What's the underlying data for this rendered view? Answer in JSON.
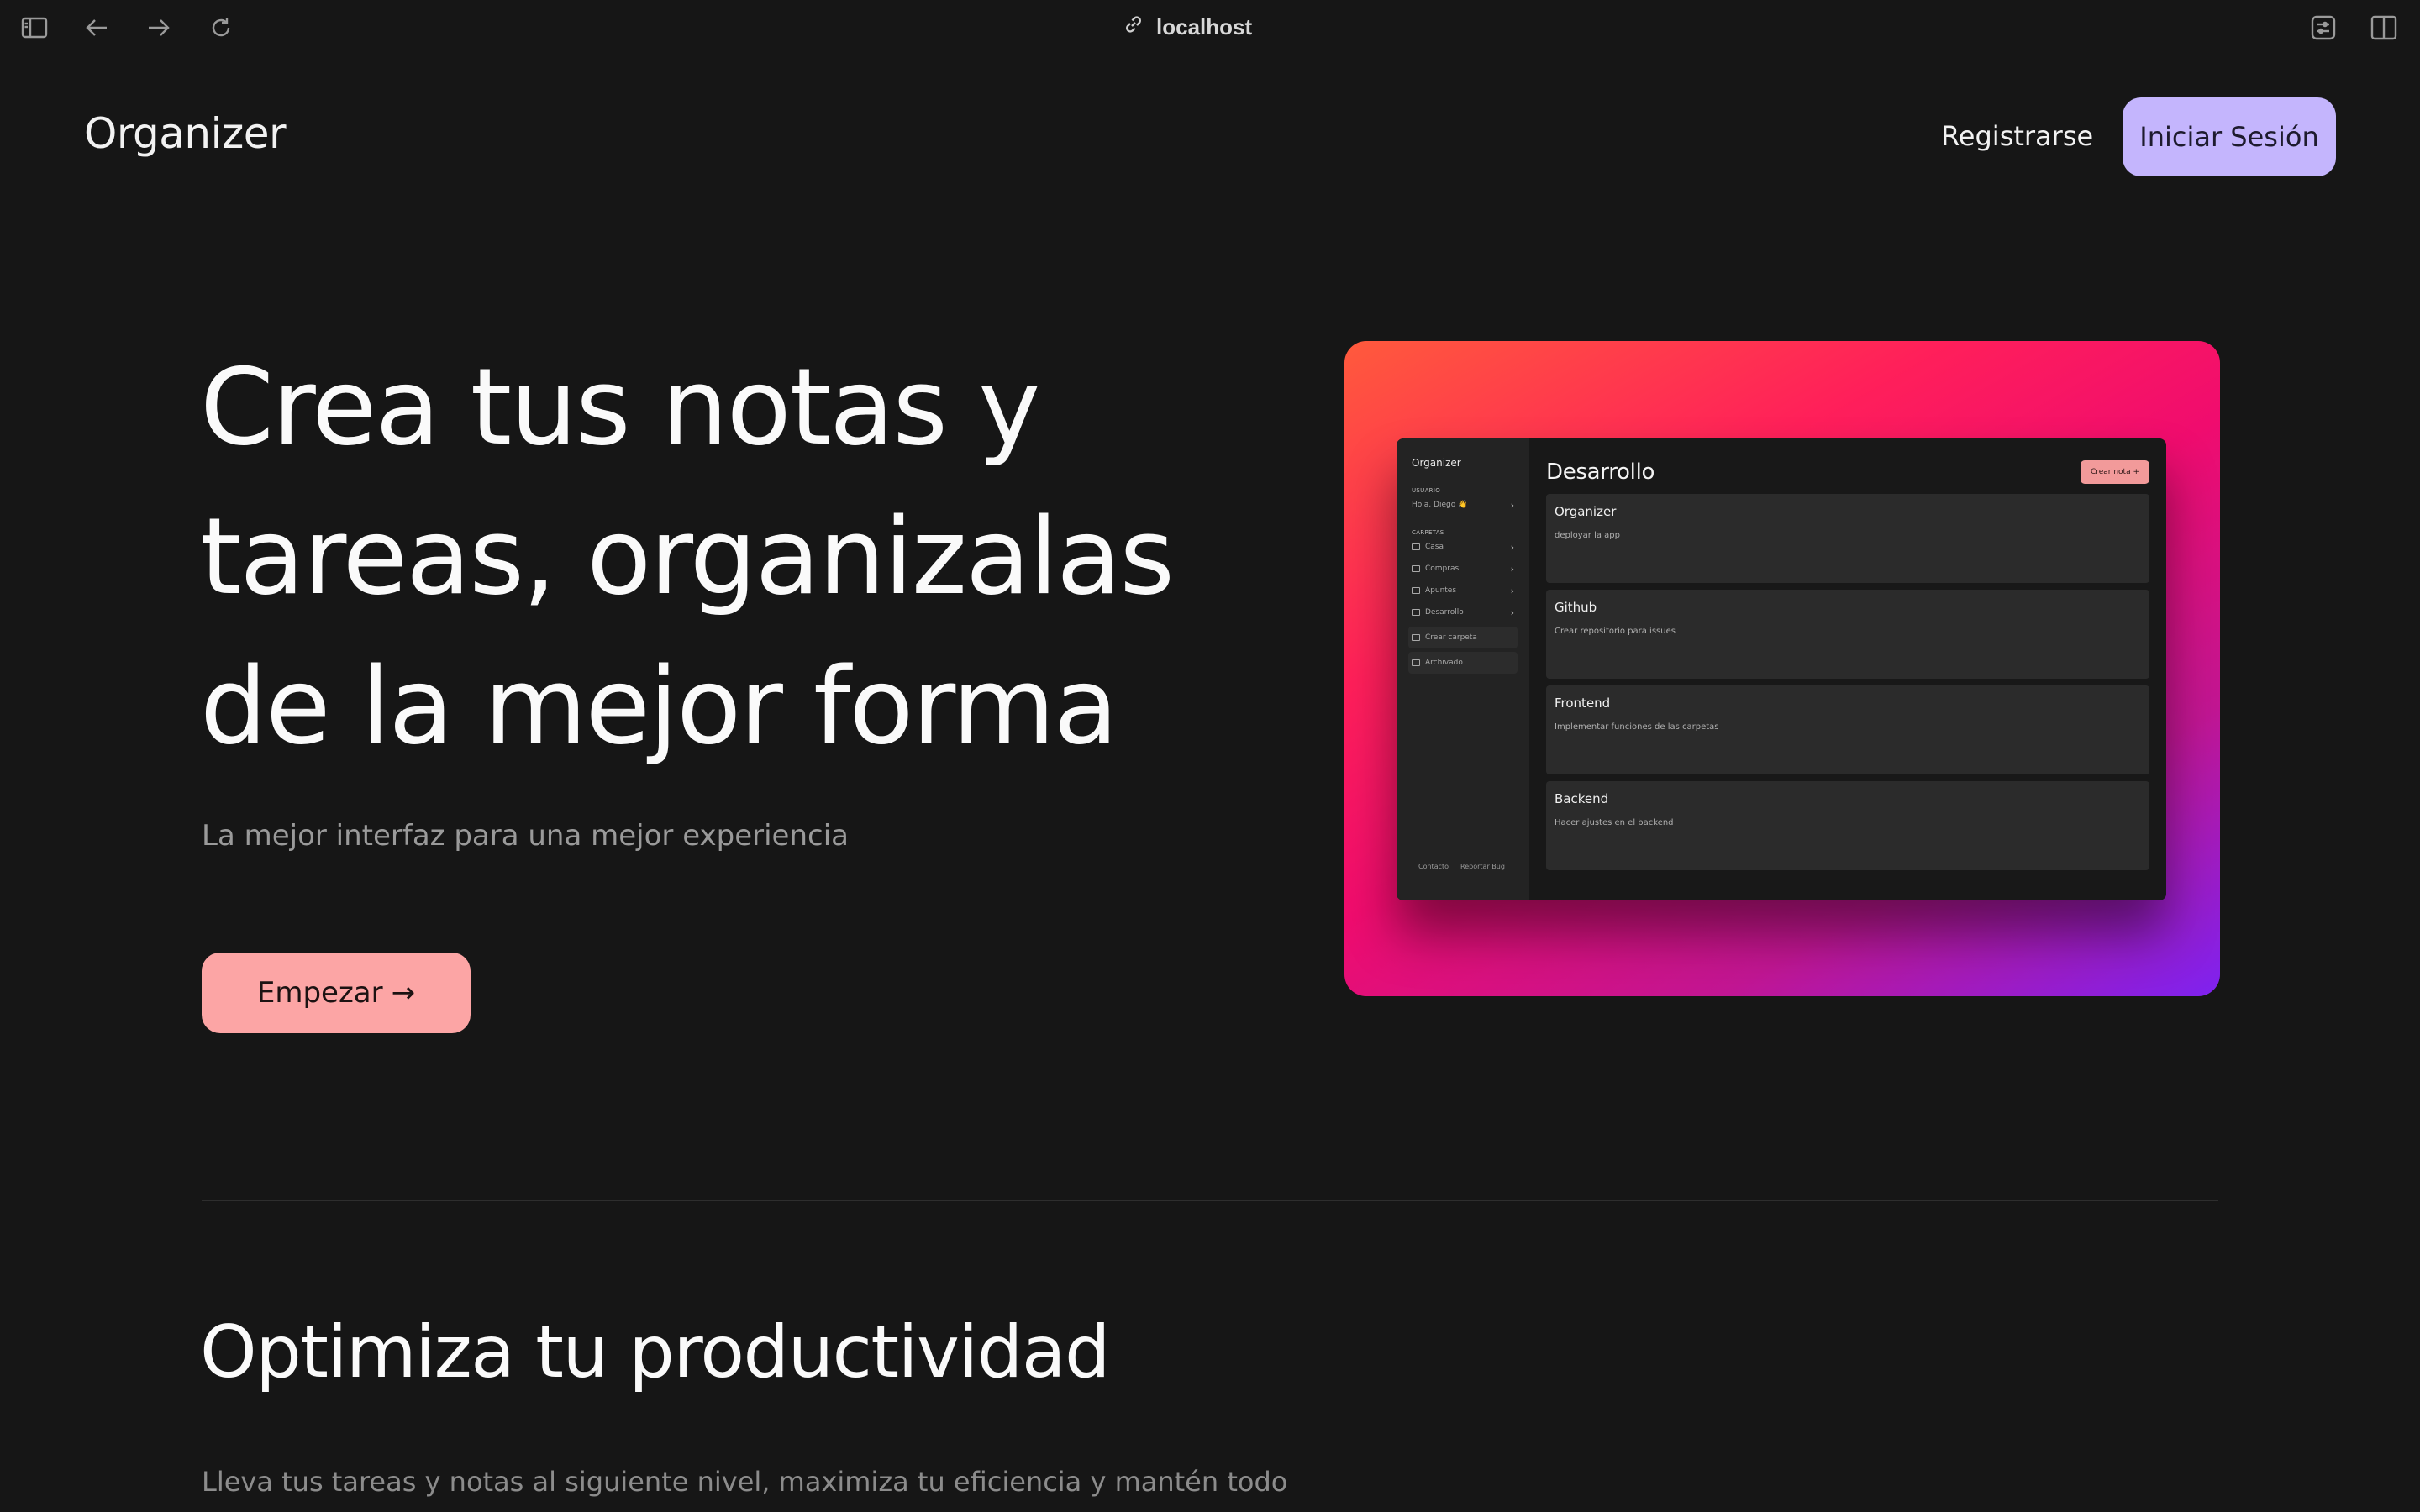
{
  "browser": {
    "url": "localhost",
    "icons": [
      "sidebar-toggle-icon",
      "back-arrow-icon",
      "forward-arrow-icon",
      "reload-icon",
      "link-icon",
      "extensions-icon",
      "split-view-icon"
    ]
  },
  "nav": {
    "brand": "Organizer",
    "register_label": "Registrarse",
    "login_label": "Iniciar Sesión"
  },
  "hero": {
    "title_lines": [
      "Crea tus notas y",
      "tareas, organizalas",
      "de la mejor forma"
    ],
    "subtitle": "La mejor interfaz para una mejor experiencia",
    "cta_label": "Empezar",
    "cta_icon": "→"
  },
  "preview_app": {
    "brand": "Organizer",
    "user_section": "USUARIO",
    "greeting": "Hola, Diego 👋",
    "folders_section": "CARPETAS",
    "folders": [
      "Casa",
      "Compras",
      "Apuntes",
      "Desarrollo"
    ],
    "create_folder": "Crear carpeta",
    "archived": "Archivado",
    "footer_links": [
      "Contacto",
      "Reportar Bug"
    ],
    "title": "Desarrollo",
    "new_note_label": "Crear nota +",
    "notes": [
      {
        "title": "Organizer",
        "description": "deployar la app"
      },
      {
        "title": "Github",
        "description": "Crear repositorio para issues"
      },
      {
        "title": "Frontend",
        "description": "Implementar funciones de las carpetas"
      },
      {
        "title": "Backend",
        "description": "Hacer ajustes en el backend"
      }
    ]
  },
  "section": {
    "title": "Optimiza tu productividad",
    "text": "Lleva tus tareas y notas al siguiente nivel, maximiza tu eficiencia y mantén todo"
  },
  "colors": {
    "background": "#161616",
    "login_button": "#c4b5fd",
    "cta_button": "#fca5a5",
    "gradient": [
      "#ff5a3c",
      "#ff1f5a",
      "#f00c6e",
      "#c21693",
      "#7e22f0"
    ]
  }
}
